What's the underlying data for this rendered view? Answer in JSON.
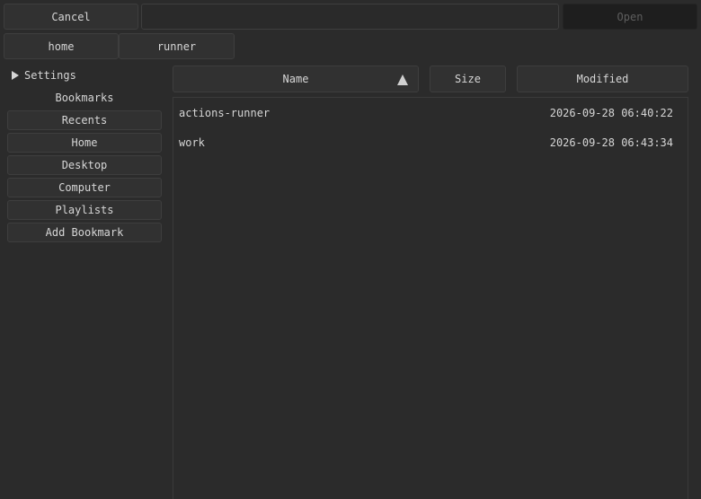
{
  "toolbar": {
    "cancel_label": "Cancel",
    "path_value": "",
    "open_label": "Open"
  },
  "breadcrumb": [
    "home",
    "runner"
  ],
  "sidebar": {
    "settings_label": "Settings",
    "bookmarks_title": "Bookmarks",
    "items": [
      "Recents",
      "Home",
      "Desktop",
      "Computer",
      "Playlists",
      "Add Bookmark"
    ]
  },
  "columns": {
    "name": "Name",
    "size": "Size",
    "modified": "Modified",
    "sort_icon": "sort-ascending-icon"
  },
  "files": [
    {
      "name": "actions-runner",
      "size": "",
      "modified": "2026-09-28 06:40:22"
    },
    {
      "name": "work",
      "size": "",
      "modified": "2026-09-28 06:43:34"
    }
  ],
  "colors": {
    "background": "#2b2b2b",
    "button": "#313131",
    "disabled_button": "#1e1e1e",
    "text": "#d6d6d6"
  }
}
